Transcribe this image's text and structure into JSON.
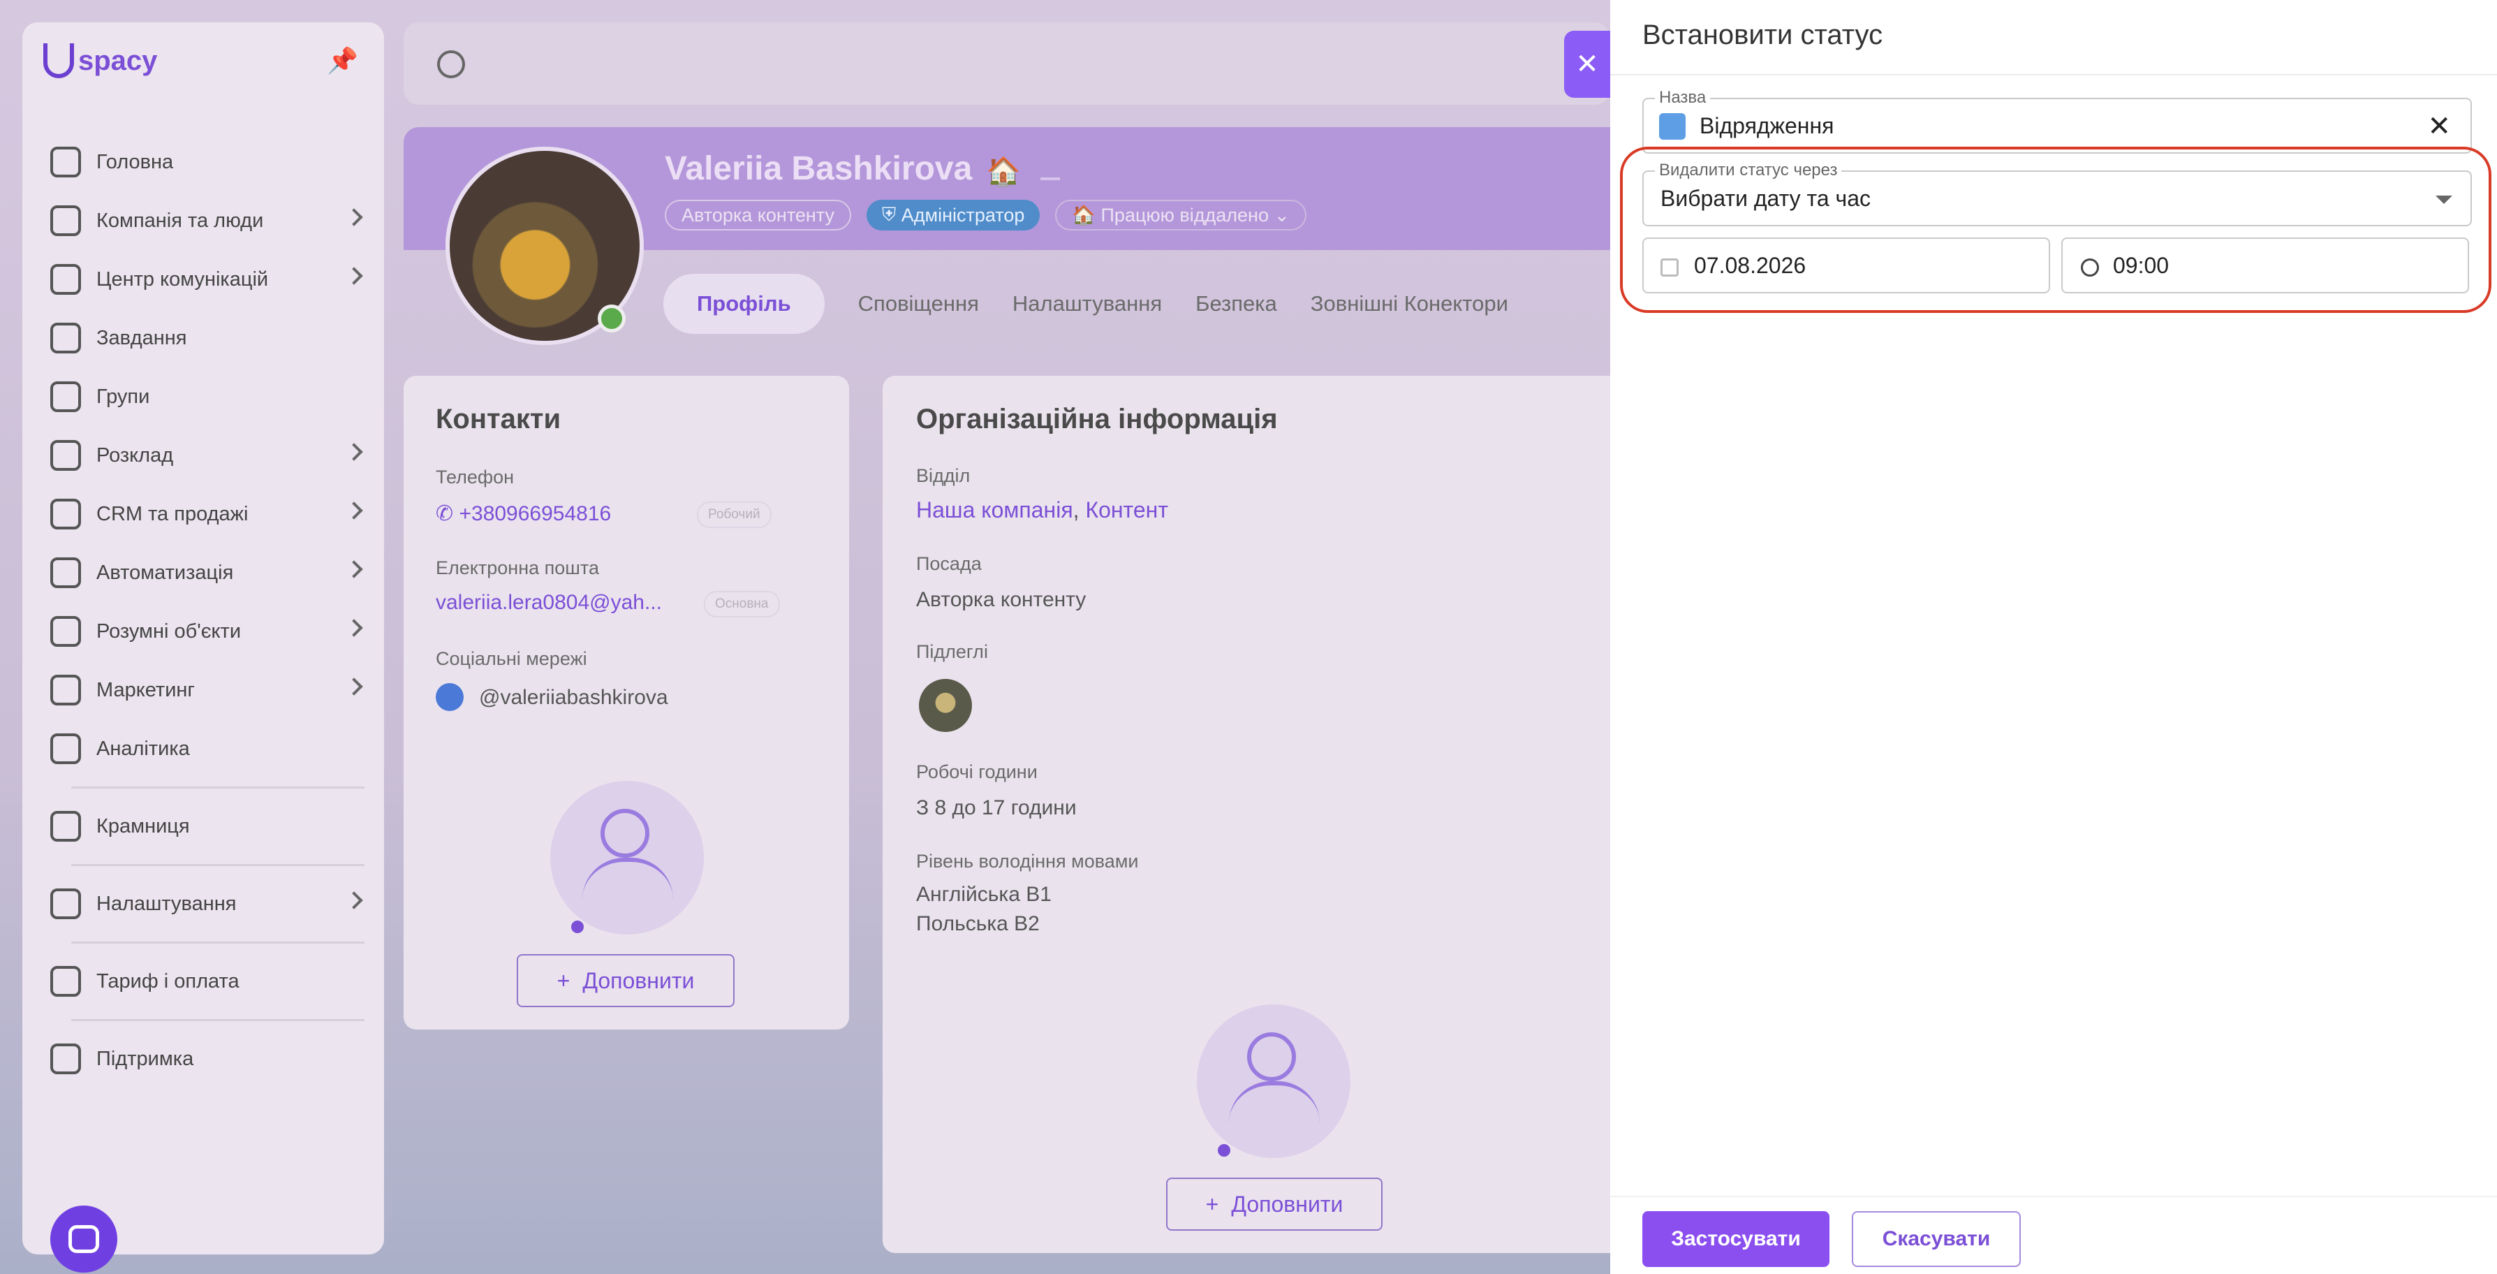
{
  "app": {
    "logo": "spacy",
    "nav": [
      {
        "label": "Головна",
        "icon": "home-icon",
        "chevron": false
      },
      {
        "label": "Компанія та люди",
        "icon": "building-icon",
        "chevron": true
      },
      {
        "label": "Центр комунікацій",
        "icon": "chat-edit-icon",
        "chevron": true
      },
      {
        "label": "Завдання",
        "icon": "check-circle-icon",
        "chevron": false
      },
      {
        "label": "Групи",
        "icon": "users-icon",
        "chevron": false
      },
      {
        "label": "Розклад",
        "icon": "calendar-icon",
        "chevron": true
      },
      {
        "label": "CRM та продажі",
        "icon": "database-icon",
        "chevron": true
      },
      {
        "label": "Автоматизація",
        "icon": "lightning-icon",
        "chevron": true
      },
      {
        "label": "Розумні об'єкти",
        "icon": "scan-icon",
        "chevron": true
      },
      {
        "label": "Маркетинг",
        "icon": "megaphone-icon",
        "chevron": true
      },
      {
        "label": "Аналітика",
        "icon": "chart-icon",
        "chevron": false
      }
    ],
    "nav2": [
      {
        "label": "Крамниця",
        "icon": "store-icon",
        "chevron": false
      }
    ],
    "nav3": [
      {
        "label": "Налаштування",
        "icon": "gear-icon",
        "chevron": true
      }
    ],
    "nav4": [
      {
        "label": "Тариф і оплата",
        "icon": "wallet-icon",
        "chevron": false
      }
    ],
    "nav5": [
      {
        "label": "Підтримка",
        "icon": "help-icon",
        "chevron": false
      }
    ]
  },
  "profile": {
    "name": "Valeriia Bashkirova",
    "badges": {
      "role": "Авторка контенту",
      "admin": "Адміністратор",
      "status": "Працюю віддалено"
    },
    "tabs": [
      "Профіль",
      "Сповіщення",
      "Налаштування",
      "Безпека",
      "Зовнішні Конектори"
    ]
  },
  "contacts": {
    "title": "Контакти",
    "phone_label": "Телефон",
    "phone": "+380966954816",
    "phone_tag": "Робочий",
    "email_label": "Електронна пошта",
    "email": "valeriia.lera0804@yah...",
    "email_tag": "Основна",
    "social_label": "Соціальні мережі",
    "social": "@valeriiabashkirova",
    "add": "Доповнити"
  },
  "org": {
    "title": "Організаційна інформація",
    "dept_label": "Відділ",
    "dept1": "Наша компанія",
    "dept2": "Контент",
    "position_label": "Посада",
    "position": "Авторка контенту",
    "subordinates_label": "Підлеглі",
    "hours_label": "Робочі години",
    "hours": "З 8 до 17 години",
    "lang_label": "Рівень володіння мовами",
    "lang1": "Англійська B1",
    "lang2": "Польська B2",
    "add": "Доповнити"
  },
  "drawer": {
    "title": "Встановити статус",
    "name_legend": "Назва",
    "name_value": "Відрядження",
    "remove_legend": "Видалити статус через",
    "remove_value": "Вибрати дату та час",
    "date": "07.08.2026",
    "time": "09:00",
    "apply": "Застосувати",
    "cancel": "Скасувати"
  },
  "colors": {
    "accent": "#8b4ff0",
    "highlight": "#d93a26",
    "admin_badge": "#4f8cc9"
  }
}
